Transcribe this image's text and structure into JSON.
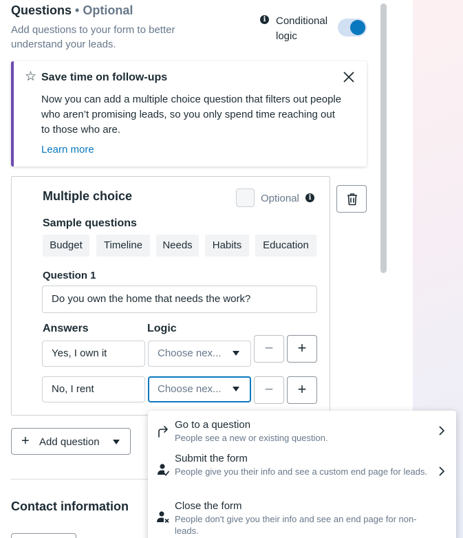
{
  "section": {
    "title": "Questions",
    "title_suffix": "• Optional",
    "subtitle": "Add questions to your form to better understand your leads.",
    "conditional_logic_label": "Conditional logic",
    "conditional_logic_on": true
  },
  "banner": {
    "title": "Save time on follow-ups",
    "text": "Now you can add a multiple choice question that filters out people who aren’t promising leads, so you only spend time reaching out to those who are.",
    "learn_more": "Learn more",
    "accent_color": "#6d4ab0"
  },
  "question_card": {
    "title": "Multiple choice",
    "optional_label": "Optional",
    "sample_questions_label": "Sample questions",
    "samples": [
      "Budget",
      "Timeline",
      "Needs",
      "Habits",
      "Education"
    ],
    "question_label": "Question 1",
    "question_value": "Do you own the home that needs the work?",
    "answers_label": "Answers",
    "logic_label": "Logic",
    "answers": [
      {
        "value": "Yes, I own it",
        "logic_placeholder": "Choose nex..."
      },
      {
        "value": "No, I rent",
        "logic_placeholder": "Choose nex..."
      }
    ],
    "minus_symbol": "−",
    "plus_symbol": "+"
  },
  "add_question": {
    "label": "Add question",
    "plus": "+"
  },
  "contact": {
    "title": "Contact information"
  },
  "dropdown": {
    "items": [
      {
        "title": "Go to a question",
        "desc": "People see a new or existing question.",
        "icon": "redirect-arrow-icon",
        "has_submenu": true
      },
      {
        "title": "Submit the form",
        "desc": "People give you their info and see a custom end page for leads.",
        "icon": "person-check-icon",
        "has_submenu": true
      },
      {
        "title": "Close the form",
        "desc": "People don't give you their info and see an end page for non-leads.",
        "icon": "person-x-icon",
        "has_submenu": false
      }
    ]
  },
  "colors": {
    "accent": "#0a78be",
    "text": "#1c2b33",
    "muted": "#67788a"
  }
}
